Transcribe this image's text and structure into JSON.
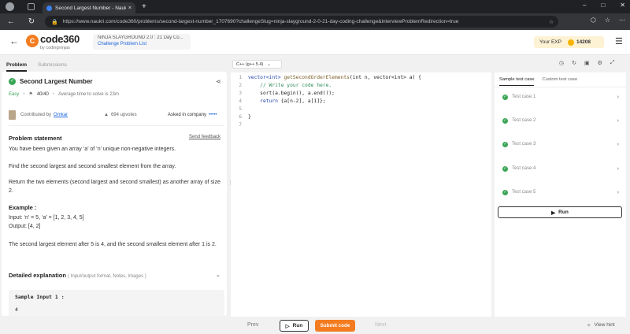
{
  "browser": {
    "tab_title": "Second Largest Number - Naukri",
    "tab_close": "×",
    "new_tab": "+",
    "url": "https://www.naukri.com/code360/problems/second-largest-number_1707690?challengeSlug=ninja-slayground-2-0-21-day-coding-challenge&interviewProblemRedirection=true"
  },
  "header": {
    "logo_text": "code360",
    "logo_sub": "by codingninjas",
    "crumb_title": "NINJA SLAYGROUND 2.0 : 21 Day Co...",
    "crumb_link": "Challenge Problem List",
    "exp_label": "Your EXP",
    "exp_value": "14208"
  },
  "problem_tabs": [
    "Problem",
    "Submissions"
  ],
  "problem": {
    "title": "Second Largest Number",
    "difficulty": "Easy",
    "score": "40/40",
    "avg_time": "Average time to solve is 23m",
    "contributed_label": "Contributed by",
    "contributor": "Omkar",
    "upvotes": "694 upvotes",
    "company_label": "Asked in company",
    "company_dots": "•••••",
    "statement_heading": "Problem statement",
    "send_feedback": "Send feedback",
    "para1": "You have been given an array ‘a’ of ‘n’ unique non-negative integers.",
    "para2": "Find the second largest and second smallest element from the array.",
    "para3": "Return the two elements (second largest and second smallest) as another array of size 2.",
    "example_heading": "Example :",
    "example_input": "Input: ‘n’ = 5, ‘a’ = [1, 2, 3, 4, 5]",
    "example_output": "Output: [4, 2]",
    "explanation": "The second largest element after 5 is 4, and the second smallest element after 1 is 2.",
    "detailed_heading": "Detailed explanation",
    "detailed_sub": "( Input/output format, Notes, Images )",
    "sample_label": "Sample Input 1 :",
    "sample_value": "4"
  },
  "editor": {
    "language": "C++ (g++ 5.4)",
    "line_numbers": [
      "1",
      "2",
      "3",
      "4",
      "5",
      "6",
      "7"
    ],
    "code": {
      "l1_type": "vector<int>",
      "l1_fn": " getSecondOrderElements",
      "l1_args": "(int n, vector<int> a) {",
      "l2": "    // Write your code here.",
      "l3": "    sort(a.begin(), a.end());",
      "l4_kw": "    return",
      "l4_rest": " {a[n-2], a[1]};",
      "l5": "",
      "l6": "}",
      "l7": ""
    }
  },
  "tests": {
    "tabs": [
      "Sample test case",
      "Custom test case"
    ],
    "cases": [
      "Test case 1",
      "Test case 2",
      "Test case 3",
      "Test case 4",
      "Test case 5"
    ],
    "run_label": "Run"
  },
  "bottom": {
    "prev": "Prev",
    "run": "Run",
    "submit": "Submit code",
    "next": "Next",
    "hint": "View hint"
  }
}
